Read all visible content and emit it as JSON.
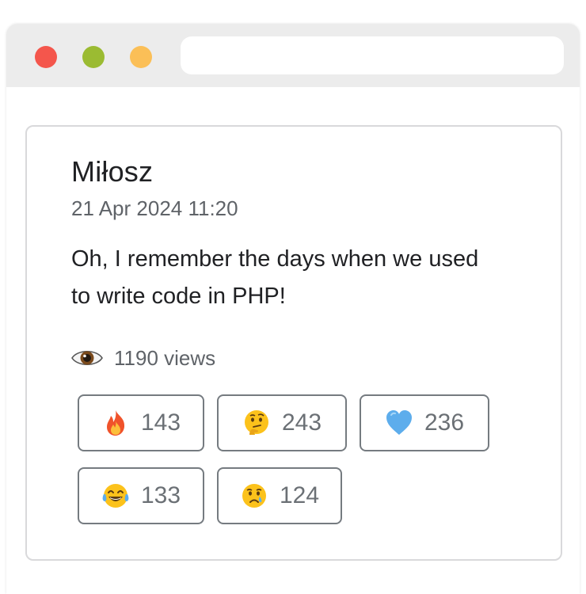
{
  "post": {
    "author": "Miłosz",
    "timestamp": "21 Apr 2024 11:20",
    "body": "Oh, I remember the days when we used to write code in PHP!",
    "views_label": "1190 views"
  },
  "reactions": [
    {
      "icon": "fire-icon",
      "count": "143"
    },
    {
      "icon": "thinking-face-icon",
      "count": "243"
    },
    {
      "icon": "blue-heart-icon",
      "count": "236"
    },
    {
      "icon": "tears-of-joy-icon",
      "count": "133"
    },
    {
      "icon": "crying-face-icon",
      "count": "124"
    }
  ],
  "colors": {
    "close": "#f4564c",
    "minimize": "#9bbb32",
    "maximize": "#fbbf57",
    "titlebar": "#ececec",
    "card_border": "#d9d9db",
    "button_border": "#757b80"
  }
}
